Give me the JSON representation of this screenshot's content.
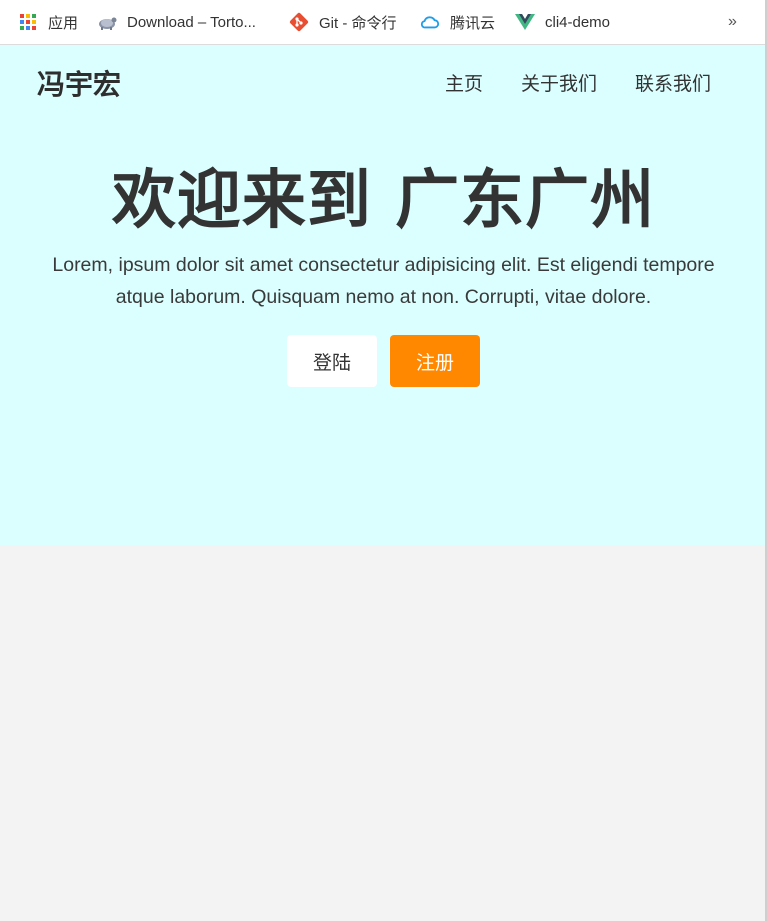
{
  "bookmarks": {
    "apps_label": "应用",
    "download_label": "Download – Torto...",
    "git_label": "Git - 命令行",
    "tencent_label": "腾讯云",
    "cli_label": "cli4-demo",
    "more_label": "»"
  },
  "header": {
    "logo": "冯宇宏",
    "nav": [
      "主页",
      "关于我们",
      "联系我们"
    ]
  },
  "hero": {
    "title": "欢迎来到 广东广州",
    "subtitle": "Lorem, ipsum dolor sit amet consectetur adipisicing elit. Est eligendi tempore atque laborum. Quisquam nemo at non. Corrupti, vitae dolore.",
    "login_label": "登陆",
    "register_label": "注册"
  },
  "colors": {
    "hero_bg": "#dbffff",
    "page_bg": "#f3f3f3",
    "register_bg": "#ff8800",
    "git_icon": "#e84e31",
    "tencent_icon": "#1f9ee8",
    "vue_green": "#41b883",
    "vue_dark": "#35495e"
  },
  "icons": {
    "apps": "apps-grid-icon",
    "download": "tortoise-icon",
    "git": "git-icon",
    "tencent": "cloud-icon",
    "cli": "vue-icon"
  }
}
